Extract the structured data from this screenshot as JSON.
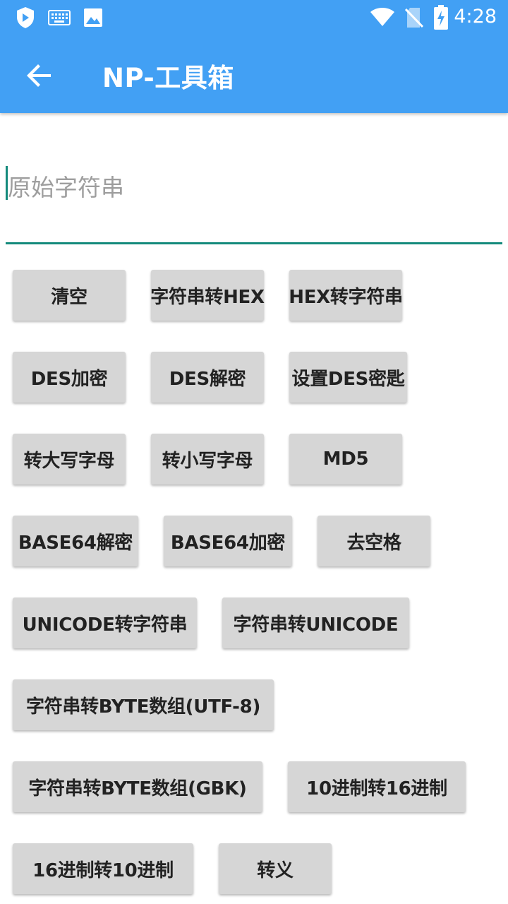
{
  "status_bar": {
    "time": "4:28",
    "left_icons": [
      "shield-icon",
      "keyboard-icon",
      "image-icon"
    ],
    "right_icons": [
      "wifi-icon",
      "no-sim-icon",
      "battery-charging-icon"
    ]
  },
  "toolbar": {
    "title": "NP-工具箱",
    "back_icon": "arrow-back-icon"
  },
  "input": {
    "placeholder": "原始字符串",
    "value": ""
  },
  "buttons": {
    "clear": "清空",
    "str_to_hex": "字符串转HEX",
    "hex_to_str": "HEX转字符串",
    "des_encrypt": "DES加密",
    "des_decrypt": "DES解密",
    "set_des_key": "设置DES密匙",
    "to_upper": "转大写字母",
    "to_lower": "转小写字母",
    "md5": "MD5",
    "base64_decode": "BASE64解密",
    "base64_encode": "BASE64加密",
    "remove_spaces": "去空格",
    "unicode_to_str": "UNICODE转字符串",
    "str_to_unicode": "字符串转UNICODE",
    "str_to_bytes_utf8": "字符串转BYTE数组(UTF-8)",
    "str_to_bytes_gbk": "字符串转BYTE数组(GBK)",
    "dec_to_hex": "10进制转16进制",
    "hex_to_dec": "16进制转10进制",
    "escape": "转义"
  },
  "colors": {
    "app_bar": "#42a0f4",
    "accent": "#148a7c",
    "button_bg": "#d6d6d6"
  }
}
